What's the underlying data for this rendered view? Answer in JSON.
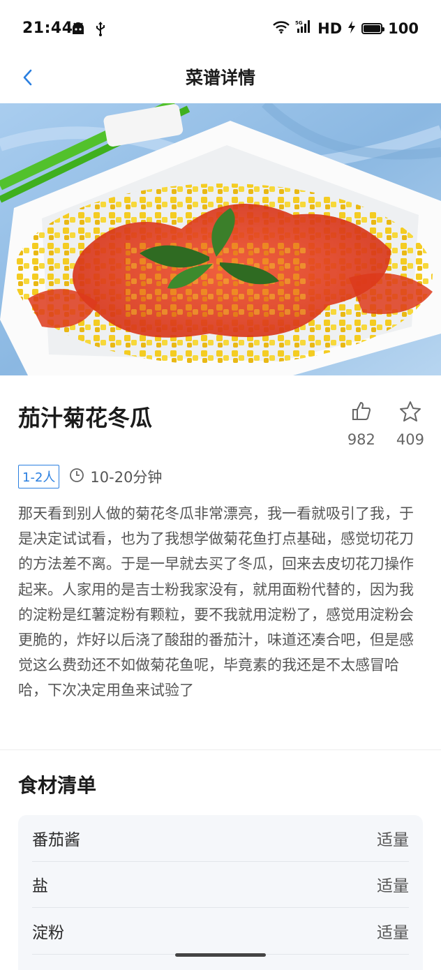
{
  "status_bar": {
    "time": "21:44",
    "network_label": "HD",
    "battery": "100",
    "battery_level": 1.0
  },
  "header": {
    "title": "菜谱详情"
  },
  "recipe": {
    "name": "茄汁菊花冬瓜",
    "likes": "982",
    "favorites": "409",
    "servings_tag": "1-2人",
    "duration": "10-20分钟",
    "description": "那天看到别人做的菊花冬瓜非常漂亮，我一看就吸引了我，于是决定试试看，也为了我想学做菊花鱼打点基础，感觉切花刀的方法差不离。于是一早就去买了冬瓜，回来去皮切花刀操作起来。人家用的是吉士粉我家没有，就用面粉代替的，因为我的淀粉是红薯淀粉有颗粒，要不我就用淀粉了，感觉用淀粉会更脆的，炸好以后浇了酸甜的番茄汁，味道还凑合吧，但是感觉这么费劲还不如做菊花鱼呢，毕竟素的我还是不太感冒哈哈，下次决定用鱼来试验了"
  },
  "ingredients": {
    "title": "食材清单",
    "items": [
      {
        "name": "番茄酱",
        "amount": "适量"
      },
      {
        "name": "盐",
        "amount": "适量"
      },
      {
        "name": "淀粉",
        "amount": "适量"
      }
    ]
  },
  "colors": {
    "accent": "#2a7fe0",
    "tomato_sauce": "#e2421f",
    "melon_yellow": "#f2c21a"
  },
  "icons": {
    "back": "chevron-left-icon",
    "like": "thumbs-up-icon",
    "favorite": "star-icon",
    "clock": "clock-icon"
  }
}
